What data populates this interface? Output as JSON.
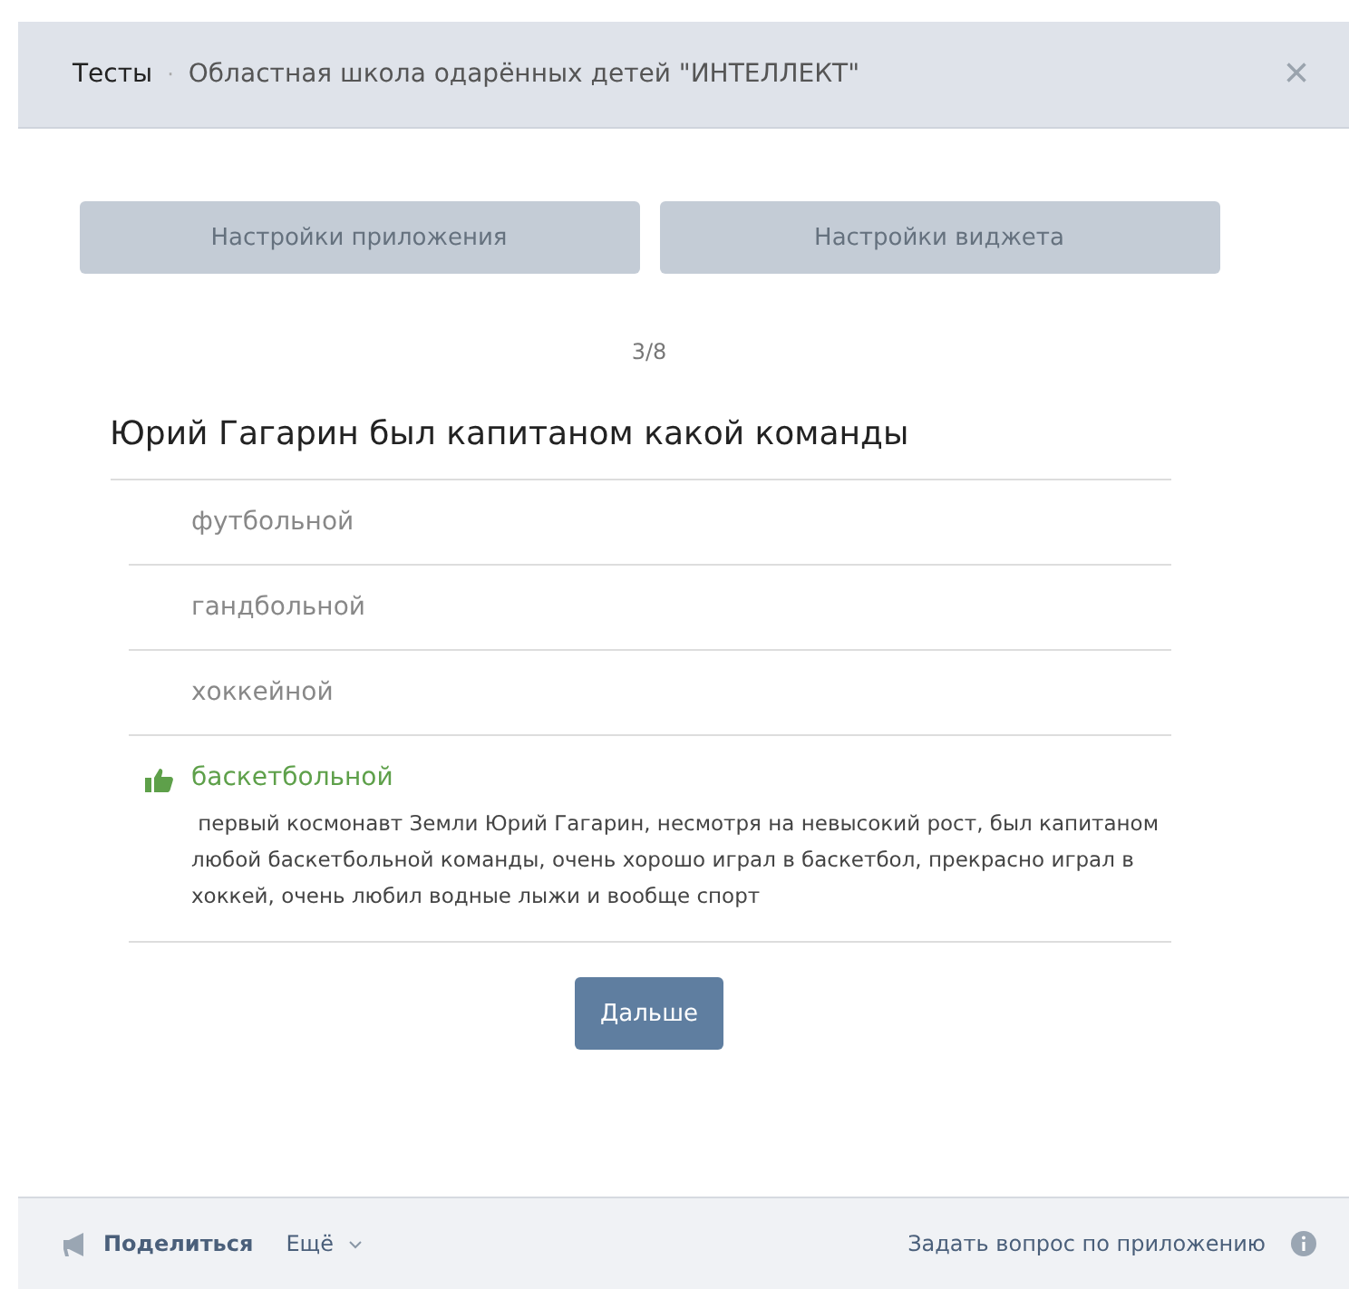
{
  "header": {
    "app": "Тесты",
    "separator": "·",
    "group": "Областная школа одарённых детей \"ИНТЕЛЛЕКТ\"",
    "close": "×"
  },
  "settings_buttons": [
    "Настройки приложения",
    "Настройки виджета"
  ],
  "progress": "3/8",
  "question": "Юрий Гагарин был капитаном какой команды",
  "answers": [
    {
      "text": "футбольной",
      "correct": false
    },
    {
      "text": "гандбольной",
      "correct": false
    },
    {
      "text": "хоккейной",
      "correct": false
    },
    {
      "text": "баскетбольной",
      "correct": true,
      "explanation": " первый космонавт Земли Юрий Гагарин, несмотря на невысокий рост, был капитаном любой баскетбольной команды, очень хорошо играл в баскетбол, прекрасно играл в хоккей, очень любил водные лыжи и вообще спорт"
    }
  ],
  "next_button": "Дальше",
  "footer": {
    "share": "Поделиться",
    "more": "Ещё",
    "ask": "Задать вопрос по приложению"
  }
}
